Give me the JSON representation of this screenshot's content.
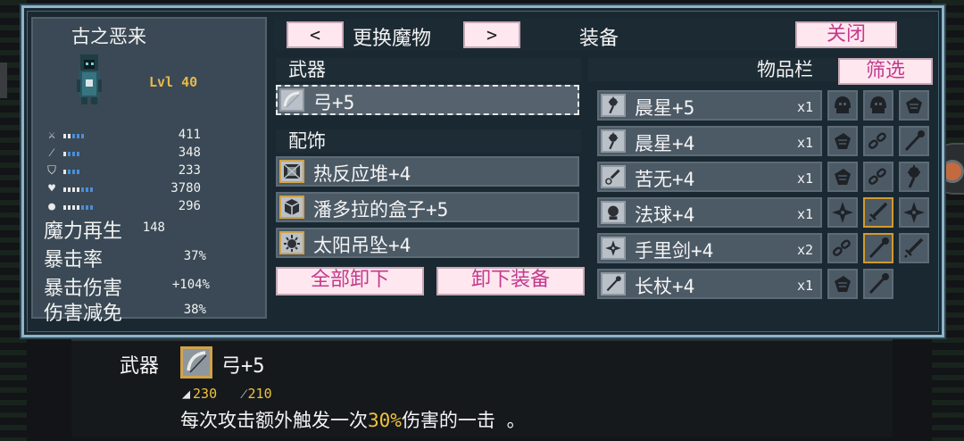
{
  "monster": {
    "name": "古之恶来",
    "level": "Lvl 40",
    "stats": [
      {
        "icon": "sword-icon",
        "glyph": "⚔",
        "value": "411",
        "fill": 0.45
      },
      {
        "icon": "staff-icon",
        "glyph": "⁄",
        "value": "348",
        "fill": 0.3
      },
      {
        "icon": "shield-icon",
        "glyph": "⛉",
        "value": "233",
        "fill": 0.35
      },
      {
        "icon": "heart-icon",
        "glyph": "♥",
        "value": "3780",
        "fill": 0.6
      },
      {
        "icon": "speed-icon",
        "glyph": "●",
        "value": "296",
        "fill": 0.55
      }
    ],
    "text_stats": [
      {
        "label": "魔力再生",
        "value": "148"
      },
      {
        "label": "暴击率",
        "value": "37%"
      },
      {
        "label": "暴击伤害",
        "value": "+104%"
      },
      {
        "label": "伤害减免",
        "value": "38%"
      }
    ]
  },
  "header": {
    "prev": "<",
    "switch_label": "更换魔物",
    "next": ">",
    "tab_title": "装备",
    "close": "关闭"
  },
  "equipment": {
    "weapon_header": "武器",
    "weapon": {
      "name": "弓+5",
      "icon": "bow-icon"
    },
    "accessory_header": "配饰",
    "accessories": [
      {
        "name": "热反应堆+4",
        "icon": "reactor-icon"
      },
      {
        "name": "潘多拉的盒子+5",
        "icon": "box-icon"
      },
      {
        "name": "太阳吊坠+4",
        "icon": "sun-pendant-icon"
      }
    ],
    "unequip_all": "全部卸下",
    "unequip": "卸下装备"
  },
  "inventory": {
    "title": "物品栏",
    "filter": "筛选",
    "items": [
      {
        "name": "晨星+5",
        "qty": "x1",
        "icon": "morningstar-icon"
      },
      {
        "name": "晨星+4",
        "qty": "x1",
        "icon": "morningstar-icon"
      },
      {
        "name": "苦无+4",
        "qty": "x1",
        "icon": "kunai-icon"
      },
      {
        "name": "法球+4",
        "qty": "x1",
        "icon": "orb-icon"
      },
      {
        "name": "手里剑+4",
        "qty": "x2",
        "icon": "shuriken-icon"
      },
      {
        "name": "长杖+4",
        "qty": "x1",
        "icon": "staff-icon"
      }
    ],
    "grid": [
      [
        "helmet-icon",
        "helmet-icon",
        "gauntlet-icon"
      ],
      [
        "gauntlet-icon",
        "chain-icon",
        "staff-icon"
      ],
      [
        "gauntlet-icon",
        "chain-icon",
        "morningstar-icon"
      ],
      [
        "shuriken-icon",
        "sword-icon",
        "shuriken-icon"
      ],
      [
        "chain-icon",
        "staff-icon",
        "sword-icon"
      ],
      [
        "gauntlet-icon",
        "staff-icon"
      ]
    ]
  },
  "tooltip": {
    "category": "武器",
    "name": "弓+5",
    "stat1_icon": "◢",
    "stat1": "230",
    "stat2_icon": "⁄",
    "stat2": "210",
    "desc_before": "每次攻击额外触发一次",
    "desc_highlight": "30%",
    "desc_after": "伤害的一击 。"
  }
}
